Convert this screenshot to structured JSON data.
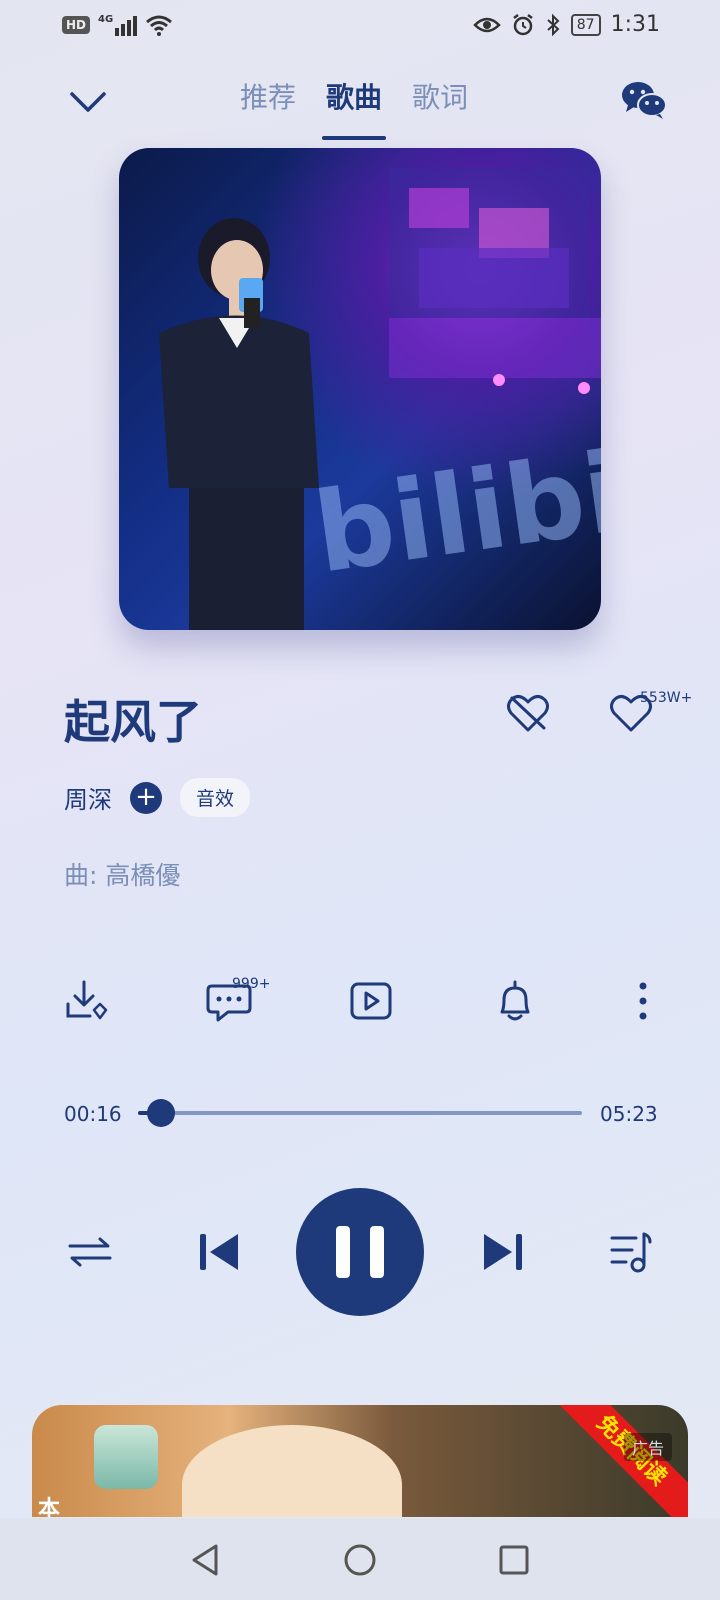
{
  "status_bar": {
    "hd": "HD",
    "network": "4G",
    "battery": "87",
    "time": "1:31"
  },
  "nav": {
    "tabs": [
      {
        "label": "推荐",
        "active": false
      },
      {
        "label": "歌曲",
        "active": true
      },
      {
        "label": "歌词",
        "active": false
      }
    ]
  },
  "song": {
    "title": "起风了",
    "like_count": "553W+",
    "artist": "周深",
    "sfx_label": "音效",
    "composer": "曲: 高橋優"
  },
  "actions": {
    "comment_count": "999+"
  },
  "progress": {
    "current": "00:16",
    "total": "05:23",
    "fraction": 0.051
  },
  "banner": {
    "corner_text": "免费阅读",
    "ad_label": "广告",
    "text": "本"
  },
  "colors": {
    "primary": "#1f3a7a",
    "muted": "#7b8fb8",
    "ad_red": "#e41b1b"
  }
}
